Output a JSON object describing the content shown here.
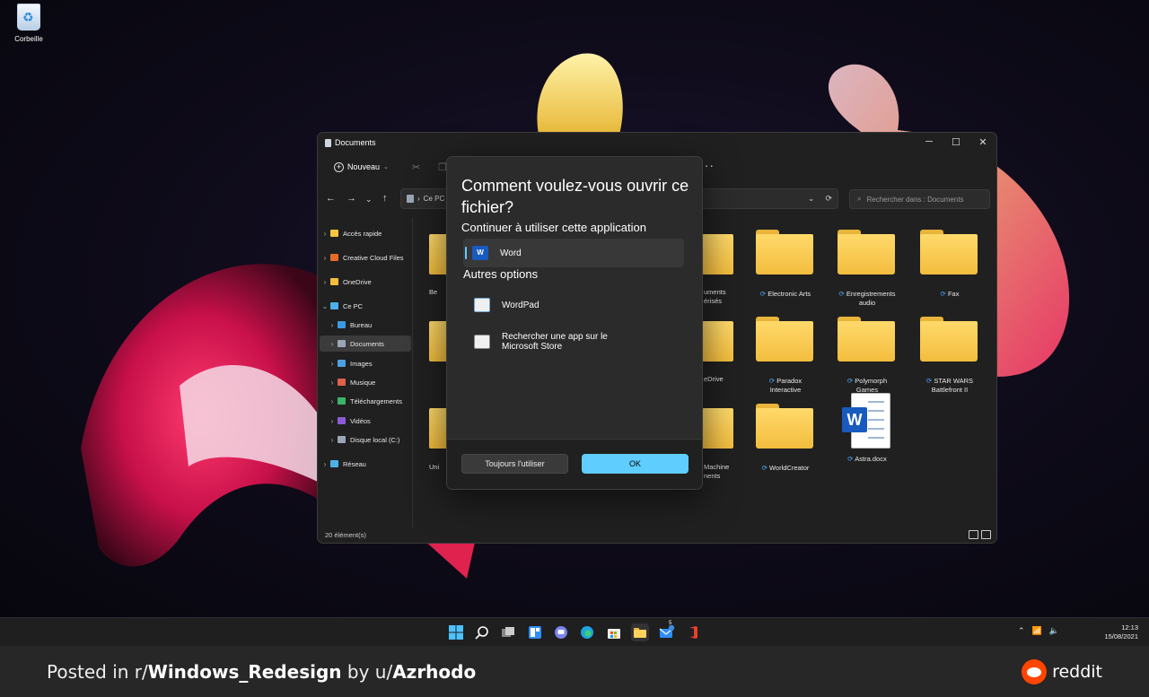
{
  "desktop": {
    "recycle_bin_label": "Corbeille"
  },
  "explorer": {
    "title": "Documents",
    "new_button": "Nouveau",
    "address": {
      "root": "Ce PC"
    },
    "search_placeholder": "Rechercher dans : Documents",
    "sidebar": [
      {
        "label": "Accès rapide",
        "icon": "star-icon",
        "color": "#f7c742"
      },
      {
        "label": "Creative Cloud Files",
        "icon": "cloud-folder-icon",
        "color": "#e86a2b"
      },
      {
        "label": "OneDrive",
        "icon": "folder-icon",
        "color": "#f3bd3e"
      },
      {
        "label": "Ce PC",
        "icon": "computer-icon",
        "color": "#4cb1e8"
      },
      {
        "label": "Bureau",
        "icon": "desktop-icon",
        "color": "#3a9ae0"
      },
      {
        "label": "Documents",
        "icon": "documents-icon",
        "color": "#9aa6b3"
      },
      {
        "label": "Images",
        "icon": "images-icon",
        "color": "#4f9fe0"
      },
      {
        "label": "Musique",
        "icon": "music-icon",
        "color": "#e0604a"
      },
      {
        "label": "Téléchargements",
        "icon": "download-icon",
        "color": "#3bb36b"
      },
      {
        "label": "Vidéos",
        "icon": "videos-icon",
        "color": "#8b5bd6"
      },
      {
        "label": "Disque local (C:)",
        "icon": "drive-icon",
        "color": "#9aa6b3"
      },
      {
        "label": "Réseau",
        "icon": "network-icon",
        "color": "#4cb1e8"
      }
    ],
    "partial_labels": [
      "Be",
      "Uni",
      "uments\nérisés",
      "eDrive",
      "Machine\nnents"
    ],
    "folders": [
      {
        "label": "Electronic Arts",
        "sync": "⟳"
      },
      {
        "label": "Enregistrements\naudio",
        "sync": "⟳"
      },
      {
        "label": "Fax",
        "sync": "⟳"
      },
      {
        "label": "Paradox\nInteractive",
        "sync": "⟳"
      },
      {
        "label": "Polymorph\nGames",
        "sync": "⟳"
      },
      {
        "label": "STAR WARS\nBattlefront II",
        "sync": "⟳"
      },
      {
        "label": "WorldCreator",
        "sync": "⟳"
      },
      {
        "label": "Astra.docx",
        "sync": "⟳"
      }
    ],
    "status": "20 élément(s)"
  },
  "dialog": {
    "title": "Comment voulez-vous ouvrir ce fichier?",
    "subtitle": "Continuer à utiliser cette application",
    "current_app": "Word",
    "other_heading": "Autres options",
    "options": [
      {
        "label": "WordPad"
      },
      {
        "label": "Rechercher une app sur le\nMicrosoft Store"
      }
    ],
    "always_button": "Toujours l'utiliser",
    "ok_button": "OK"
  },
  "taskbar": {
    "mail_badge": "5",
    "time": "12:13",
    "date": "15/08/2021"
  },
  "reddit": {
    "posted_in": "Posted in r/",
    "subreddit": "Windows_Redesign",
    "by": " by u/",
    "user": "Azrhodo",
    "brand": "reddit"
  }
}
